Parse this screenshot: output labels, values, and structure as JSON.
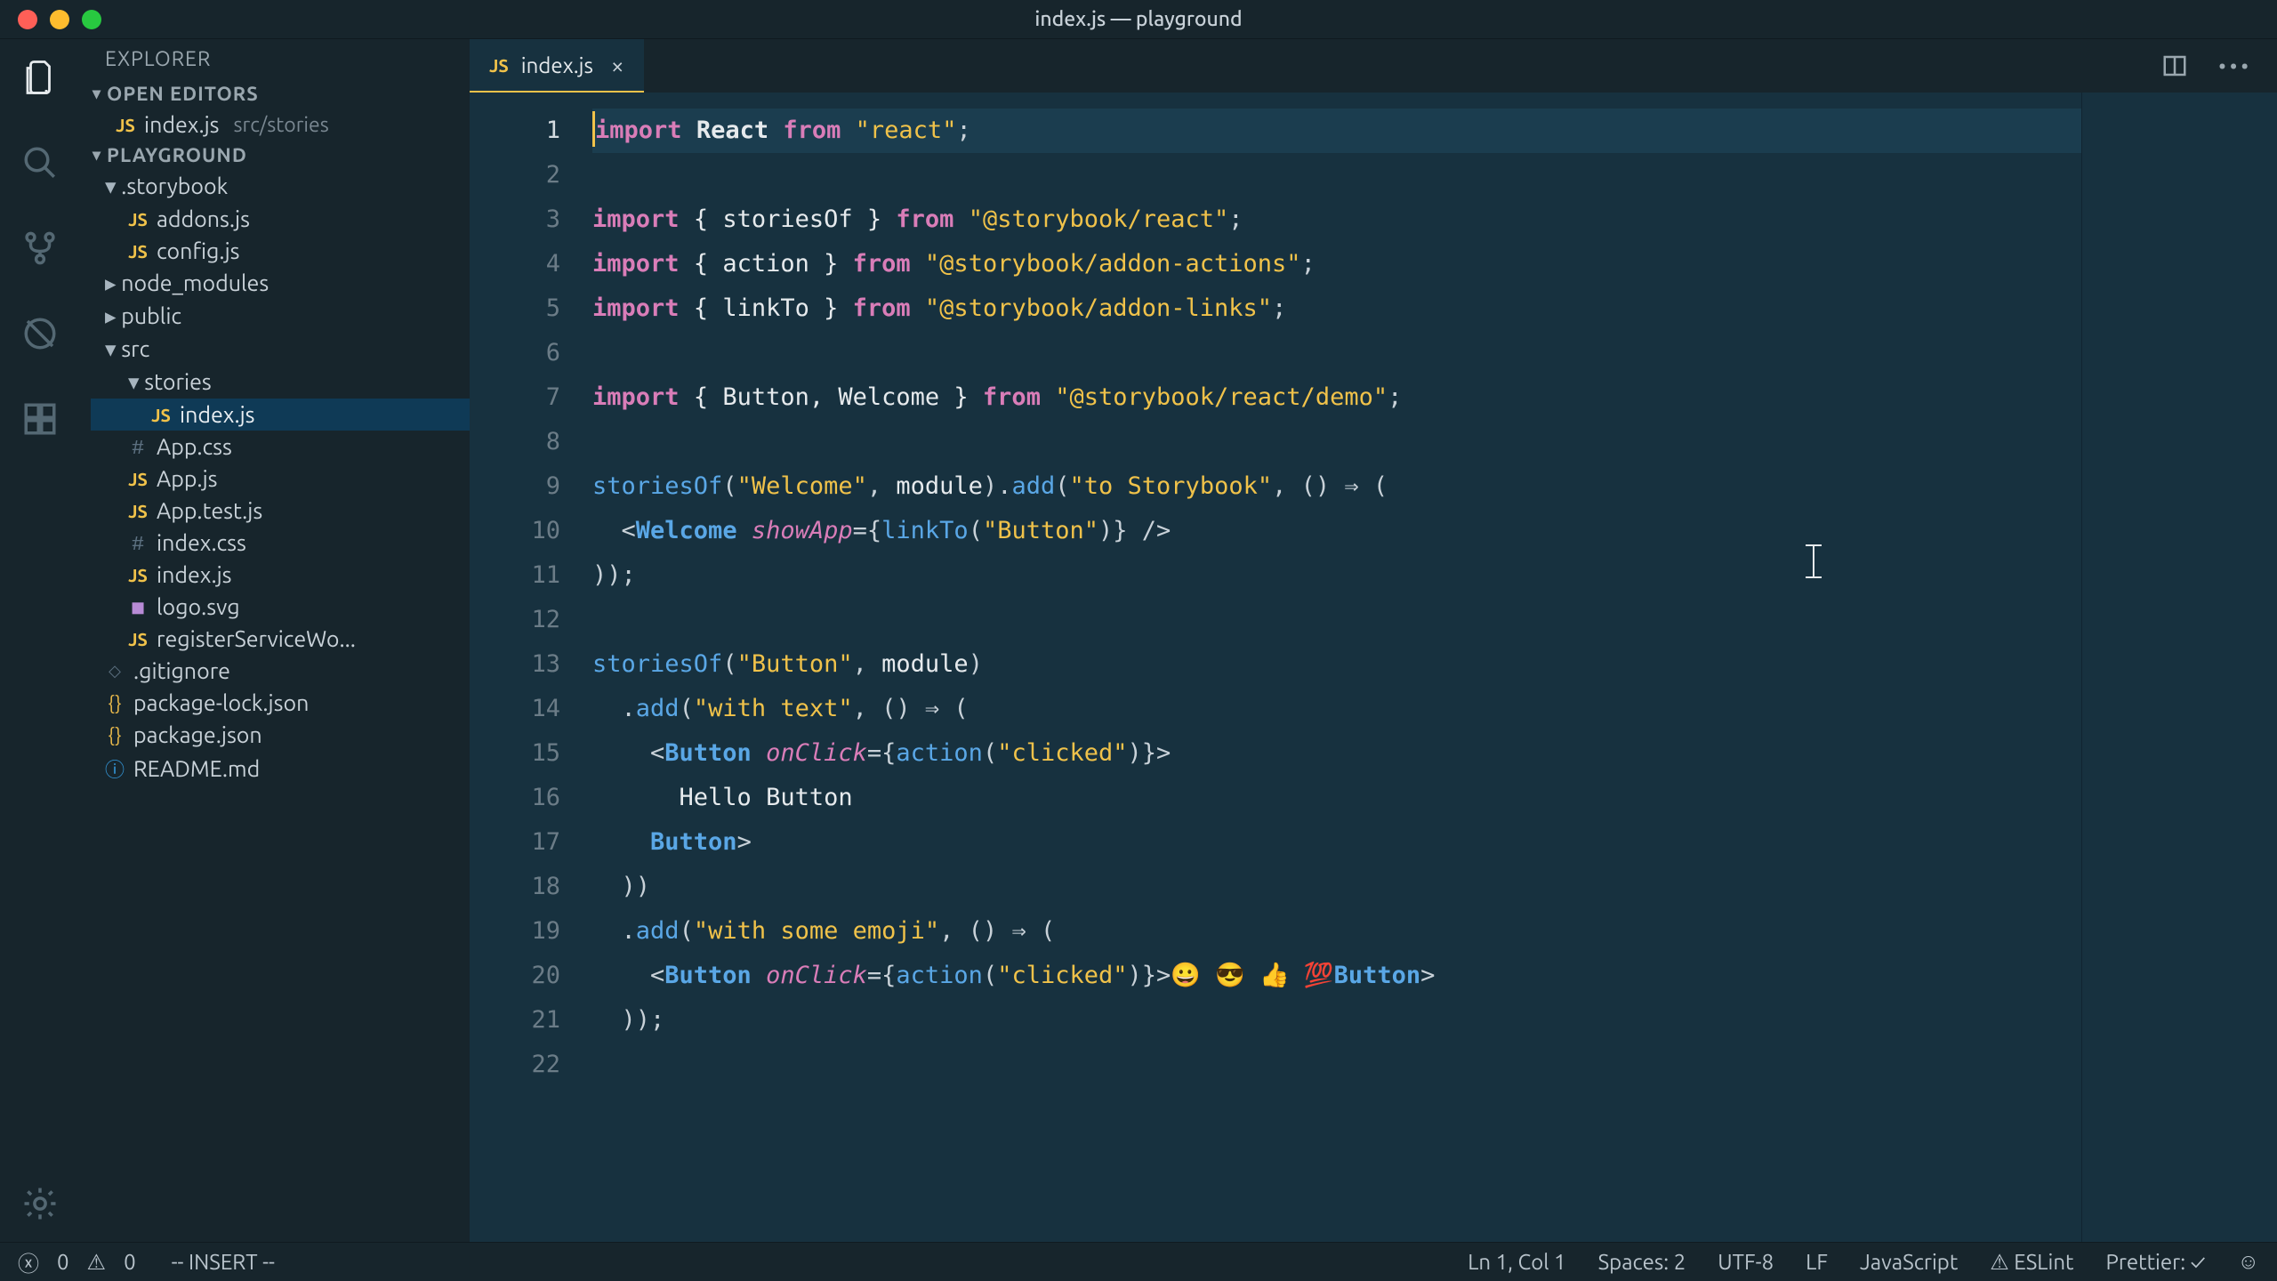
{
  "window": {
    "title": "index.js — playground"
  },
  "sidebar": {
    "header": "EXPLORER",
    "openEditors": {
      "title": "OPEN EDITORS",
      "file": {
        "icon": "JS",
        "name": "index.js",
        "path": "src/stories"
      }
    },
    "projectTitle": "PLAYGROUND",
    "tree": [
      {
        "type": "folder",
        "open": true,
        "lvl": 0,
        "name": ".storybook"
      },
      {
        "type": "file",
        "lvl": 1,
        "icon": "js",
        "name": "addons.js"
      },
      {
        "type": "file",
        "lvl": 1,
        "icon": "js",
        "name": "config.js"
      },
      {
        "type": "folder",
        "open": false,
        "lvl": 0,
        "name": "node_modules"
      },
      {
        "type": "folder",
        "open": false,
        "lvl": 0,
        "name": "public"
      },
      {
        "type": "folder",
        "open": true,
        "lvl": 0,
        "name": "src"
      },
      {
        "type": "folder",
        "open": true,
        "lvl": 1,
        "name": "stories"
      },
      {
        "type": "file",
        "lvl": 2,
        "icon": "js",
        "name": "index.js",
        "selected": true
      },
      {
        "type": "file",
        "lvl": 1,
        "icon": "hash",
        "name": "App.css"
      },
      {
        "type": "file",
        "lvl": 1,
        "icon": "js",
        "name": "App.js"
      },
      {
        "type": "file",
        "lvl": 1,
        "icon": "js",
        "name": "App.test.js"
      },
      {
        "type": "file",
        "lvl": 1,
        "icon": "hash",
        "name": "index.css"
      },
      {
        "type": "file",
        "lvl": 1,
        "icon": "js",
        "name": "index.js"
      },
      {
        "type": "file",
        "lvl": 1,
        "icon": "img",
        "name": "logo.svg"
      },
      {
        "type": "file",
        "lvl": 1,
        "icon": "js",
        "name": "registerServiceWo..."
      },
      {
        "type": "file",
        "lvl": 0,
        "icon": "diamond",
        "name": ".gitignore"
      },
      {
        "type": "file",
        "lvl": 0,
        "icon": "brace",
        "name": "package-lock.json"
      },
      {
        "type": "file",
        "lvl": 0,
        "icon": "brace",
        "name": "package.json"
      },
      {
        "type": "file",
        "lvl": 0,
        "icon": "info",
        "name": "README.md"
      }
    ]
  },
  "tab": {
    "icon": "JS",
    "name": "index.js"
  },
  "lines": 22,
  "code": {
    "l1": {
      "import": "import",
      "react": "React",
      "from": "from",
      "reactstr": "\"react\"",
      "semi": ";"
    },
    "l3": {
      "import": "import",
      "brace": "{ storiesOf } ",
      "from": "from",
      "str": "\"@storybook/react\"",
      "semi": ";"
    },
    "l4": {
      "import": "import",
      "brace": "{ action } ",
      "from": "from",
      "str": "\"@storybook/addon-actions\"",
      "semi": ";"
    },
    "l5": {
      "import": "import",
      "brace": "{ linkTo } ",
      "from": "from",
      "str": "\"@storybook/addon-links\"",
      "semi": ";"
    },
    "l7": {
      "import": "import",
      "brace": "{ Button, Welcome } ",
      "from": "from",
      "str": "\"@storybook/react/demo\"",
      "semi": ";"
    },
    "l9": {
      "a": "storiesOf",
      "p1": "(",
      "s1": "\"Welcome\"",
      "c": ", ",
      "m": "module",
      "p2": ").",
      "add": "add",
      "p3": "(",
      "s2": "\"to Storybook\"",
      "c2": ", () ⇒ ("
    },
    "l10": {
      "open": "  <",
      "tag": "Welcome",
      " ": " ",
      "attr": "showApp",
      "eq": "={",
      "fn": "linkTo",
      "p1": "(",
      "s": "\"Button\"",
      "p2": ")} />"
    },
    "l11": {
      "t": "));"
    },
    "l13": {
      "a": "storiesOf",
      "p1": "(",
      "s1": "\"Button\"",
      "c": ", ",
      "m": "module",
      "p2": ")"
    },
    "l14": {
      "pad": "  .",
      "add": "add",
      "p1": "(",
      "s": "\"with text\"",
      "rest": ", () ⇒ ("
    },
    "l15": {
      "open": "    <",
      "tag": "Button",
      " ": " ",
      "attr": "onClick",
      "eq": "={",
      "fn": "action",
      "p1": "(",
      "s": "\"clicked\"",
      "p2": ")}>"
    },
    "l16": {
      "t": "      Hello Button"
    },
    "l17": {
      "open": "    </",
      "tag": "Button",
      "close": ">"
    },
    "l18": {
      "t": "  ))"
    },
    "l19": {
      "pad": "  .",
      "add": "add",
      "p1": "(",
      "s": "\"with some emoji\"",
      "rest": ", () ⇒ ("
    },
    "l20": {
      "open": "    <",
      "tag": "Button",
      " ": " ",
      "attr": "onClick",
      "eq": "={",
      "fn": "action",
      "p1": "(",
      "s": "\"clicked\"",
      "p2": ")}>",
      "emoji": "😀 😎 👍 💯",
      "open2": "</",
      "tag2": "Button",
      "close": ">"
    },
    "l21": {
      "t": "  ));"
    }
  },
  "status": {
    "errors": "0",
    "warnings": "0",
    "mode": "-- INSERT --",
    "cursor": "Ln 1, Col 1",
    "spaces": "Spaces: 2",
    "encoding": "UTF-8",
    "eol": "LF",
    "lang": "JavaScript",
    "eslint": "ESLint",
    "prettier": "Prettier: ✓"
  }
}
